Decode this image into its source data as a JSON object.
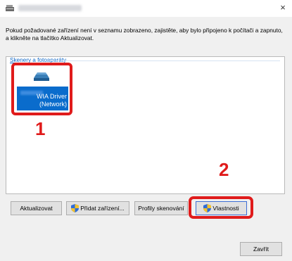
{
  "window": {
    "title": "Skenery a fotoaparáty",
    "close_glyph": "×"
  },
  "description": "Pokud požadované zařízení není v seznamu zobrazeno, zajistěte, aby bylo připojeno k počítači a zapnuto, a klikněte na tlačítko Aktualizovat.",
  "group": {
    "label": "Skenery a fotoaparáty",
    "devices": [
      {
        "name_line1": "WIA Driver",
        "name_line2": "(Network)",
        "icon": "scanner-icon",
        "selected": true
      }
    ]
  },
  "annotations": {
    "step1": "1",
    "step2": "2",
    "color": "#e01b1b"
  },
  "buttons": {
    "refresh": "Aktualizovat",
    "add_device": "Přidat zařízení...",
    "profiles": "Profily skenování",
    "properties": "Vlastnosti",
    "close": "Zavřít"
  },
  "colors": {
    "selection": "#0a6ccc",
    "link": "#0b63c4",
    "highlight": "#e01b1b"
  }
}
